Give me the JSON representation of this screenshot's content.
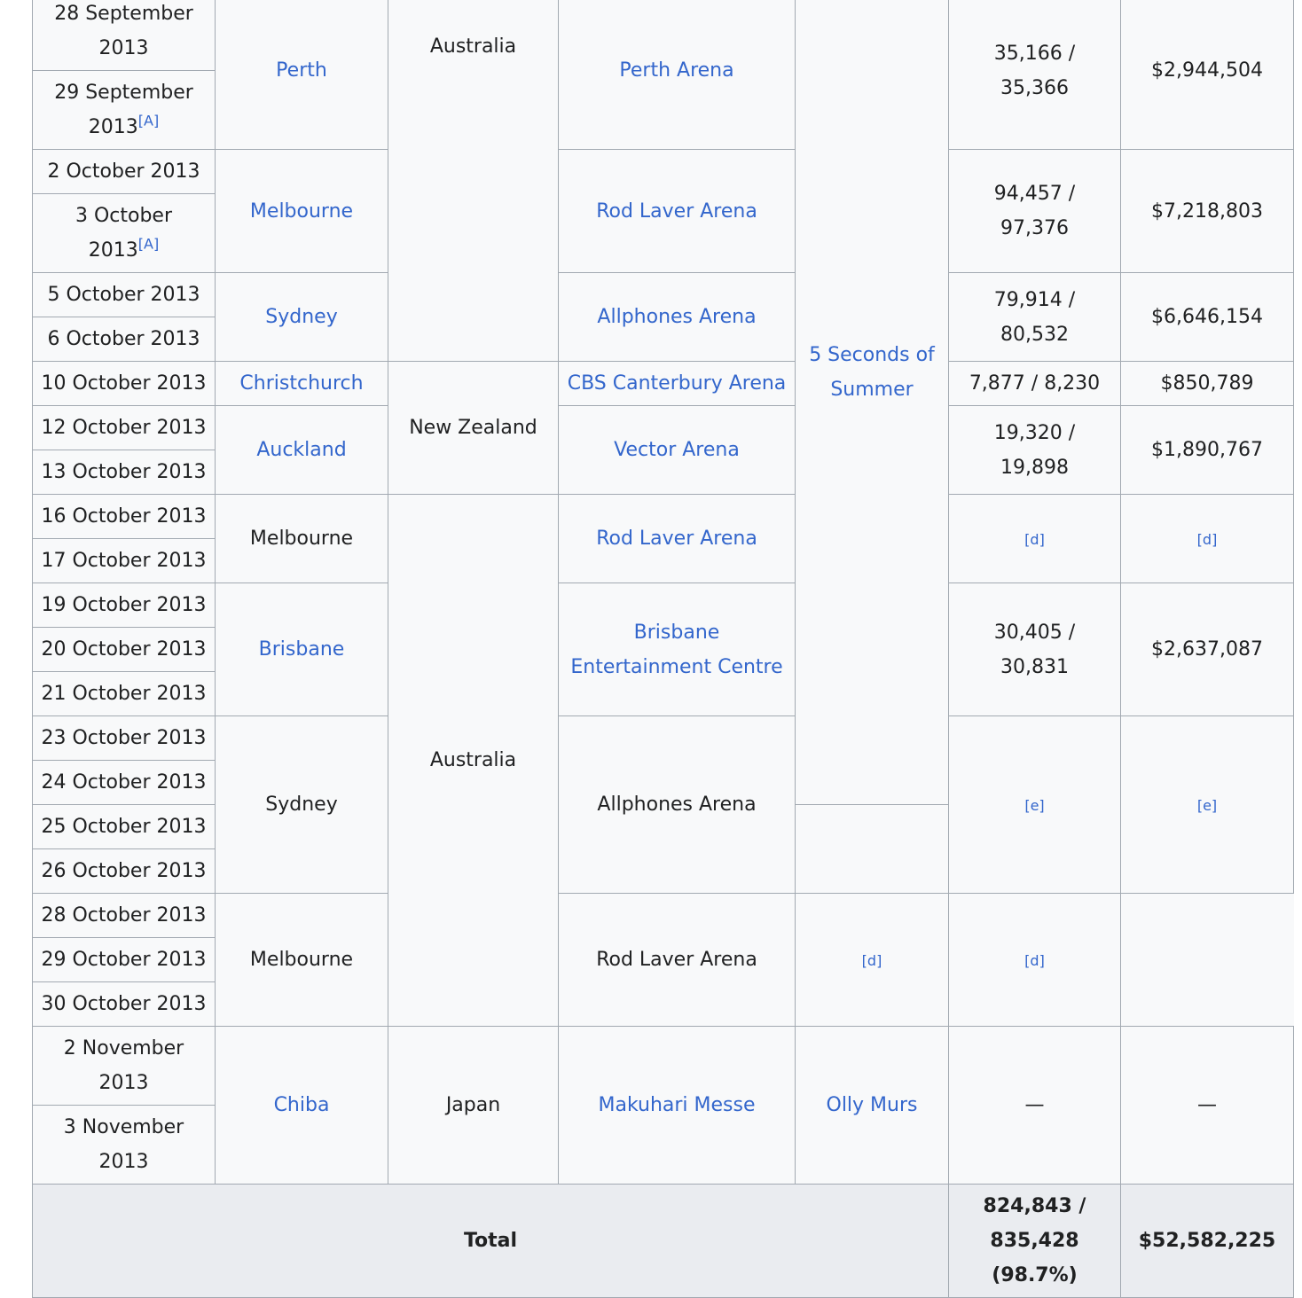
{
  "refs": {
    "A": "[A]",
    "d": "[d]",
    "e": "[e]"
  },
  "rows": {
    "r0": {
      "date": "28 September 2013",
      "city": "Perth",
      "country": "Australia",
      "venue": "Perth Arena",
      "attendance": "35,166 / 35,366",
      "revenue": "$2,944,504"
    },
    "r1": {
      "date": "29 September 2013"
    },
    "r2": {
      "date": "2 October 2013",
      "city": "Melbourne",
      "venue": "Rod Laver Arena",
      "attendance": "94,457 / 97,376",
      "revenue": "$7,218,803"
    },
    "r3": {
      "date": "3 October 2013"
    },
    "r4": {
      "date": "5 October 2013",
      "city": "Sydney",
      "venue": "Allphones Arena",
      "attendance": "79,914 / 80,532",
      "revenue": "$6,646,154"
    },
    "r5": {
      "date": "6 October 2013"
    },
    "r6": {
      "date": "10 October 2013",
      "city": "Christchurch",
      "country": "New Zealand",
      "venue": "CBS Canterbury Arena",
      "opening_act": "5 Seconds of Summer",
      "attendance": "7,877 / 8,230",
      "revenue": "$850,789"
    },
    "r7": {
      "date": "12 October 2013",
      "city": "Auckland",
      "venue": "Vector Arena",
      "attendance": "19,320 / 19,898",
      "revenue": "$1,890,767"
    },
    "r8": {
      "date": "13 October 2013"
    },
    "r9": {
      "date": "16 October 2013",
      "city": "Melbourne",
      "country": "Australia",
      "venue": "Rod Laver Arena"
    },
    "r10": {
      "date": "17 October 2013"
    },
    "r11": {
      "date": "19 October 2013",
      "city": "Brisbane",
      "venue": "Brisbane Entertainment Centre",
      "attendance": "30,405 / 30,831",
      "revenue": "$2,637,087"
    },
    "r12": {
      "date": "20 October 2013"
    },
    "r13": {
      "date": "21 October 2013"
    },
    "r14": {
      "date": "23 October 2013",
      "city": "Sydney",
      "venue": "Allphones Arena"
    },
    "r15": {
      "date": "24 October 2013"
    },
    "r16": {
      "date": "25 October 2013"
    },
    "r17": {
      "date": "26 October 2013"
    },
    "r18": {
      "date": "28 October 2013",
      "city": "Melbourne",
      "venue": "Rod Laver Arena"
    },
    "r19": {
      "date": "29 October 2013"
    },
    "r20": {
      "date": "30 October 2013"
    },
    "r21": {
      "date": "2 November 2013",
      "city": "Chiba",
      "country": "Japan",
      "venue": "Makuhari Messe",
      "opening_act": "Olly Murs",
      "attendance": "—",
      "revenue": "—"
    },
    "r22": {
      "date": "3 November 2013"
    }
  },
  "total": {
    "label": "Total",
    "attendance_line1": "824,843 /",
    "attendance_line2": "835,428",
    "attendance_line3": "(98.7%)",
    "revenue": "$52,582,225"
  },
  "colors": {
    "link": "#3366cc",
    "border": "#a2a9b1",
    "cell_bg": "#f8f9fa",
    "total_bg": "#eaecf0",
    "text": "#202122"
  }
}
